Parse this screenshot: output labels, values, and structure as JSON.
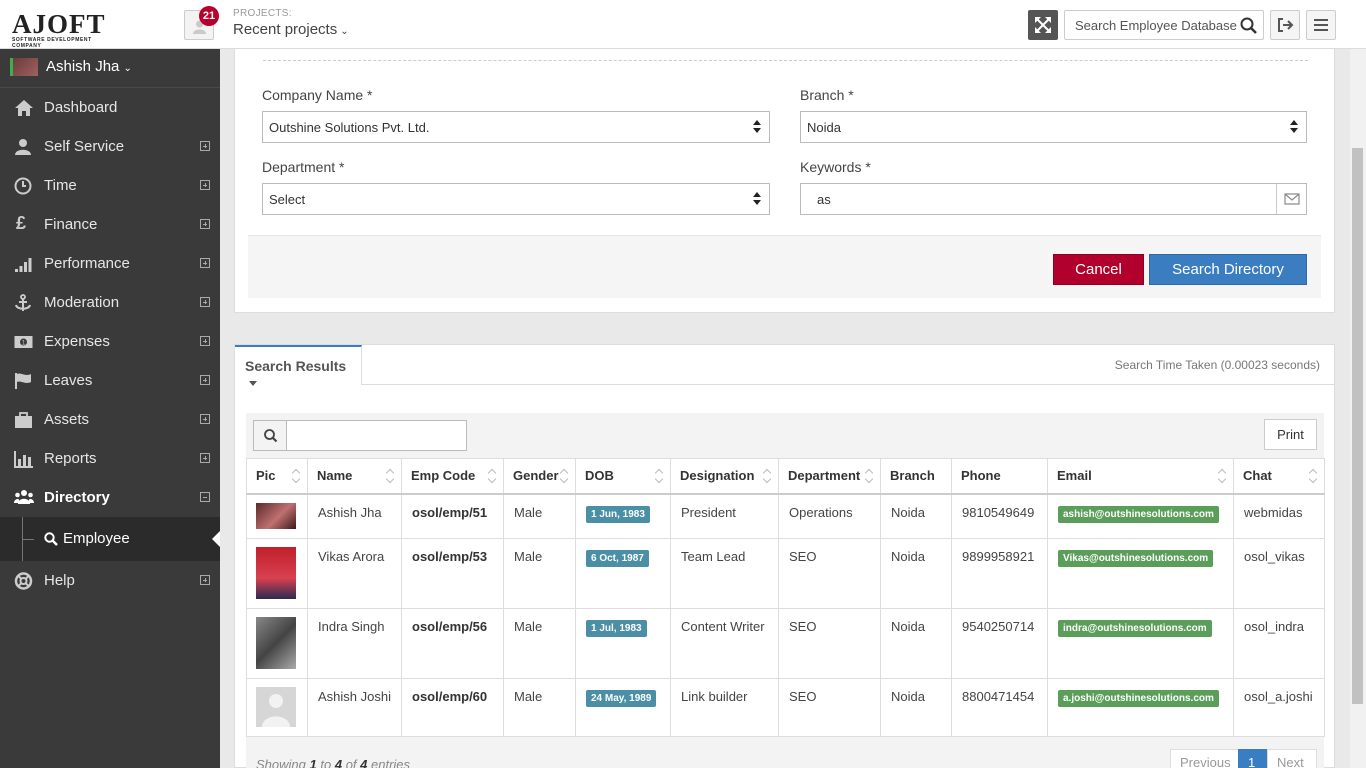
{
  "header": {
    "logo_text": "AJOFT",
    "logo_subtext": "SOFTWARE DEVELOPMENT COMPANY",
    "notification_count": "21",
    "projects_label": "PROJECTS:",
    "projects_value": "Recent projects",
    "search_placeholder": "Search Employee Database"
  },
  "sidebar": {
    "user_name": "Ashish Jha",
    "items": [
      {
        "label": "Dashboard",
        "icon": "home-icon"
      },
      {
        "label": "Self Service",
        "icon": "users-icon"
      },
      {
        "label": "Time",
        "icon": "clock-icon"
      },
      {
        "label": "Finance",
        "icon": "pound-icon"
      },
      {
        "label": "Performance",
        "icon": "signal-icon"
      },
      {
        "label": "Moderation",
        "icon": "anchor-icon"
      },
      {
        "label": "Expenses",
        "icon": "money-icon"
      },
      {
        "label": "Leaves",
        "icon": "flag-icon"
      },
      {
        "label": "Assets",
        "icon": "briefcase-icon"
      },
      {
        "label": "Reports",
        "icon": "bar-chart-icon"
      },
      {
        "label": "Directory",
        "icon": "group-icon"
      },
      {
        "label": "Help",
        "icon": "lifebuoy-icon"
      }
    ],
    "sub_item": "Employee"
  },
  "form": {
    "company_label": "Company Name *",
    "company_value": "Outshine Solutions Pvt. Ltd.",
    "branch_label": "Branch *",
    "branch_value": "Noida",
    "department_label": "Department *",
    "department_value": "Select",
    "keywords_label": "Keywords *",
    "keywords_value": "as",
    "cancel_label": "Cancel",
    "search_label": "Search Directory"
  },
  "results": {
    "tab_label": "Search Results",
    "time_taken": "Search Time Taken (0.00023 seconds)",
    "print_label": "Print",
    "columns": [
      "Pic",
      "Name",
      "Emp Code",
      "Gender",
      "DOB",
      "Designation",
      "Department",
      "Branch",
      "Phone",
      "Email",
      "Chat"
    ],
    "rows": [
      {
        "name": "Ashish Jha",
        "code": "osol/emp/51",
        "gender": "Male",
        "dob": "1 Jun, 1983",
        "designation": "President",
        "department": "Operations",
        "branch": "Noida",
        "phone": "9810549649",
        "email": "ashish@outshinesolutions.com",
        "chat": "webmidas"
      },
      {
        "name": "Vikas Arora",
        "code": "osol/emp/53",
        "gender": "Male",
        "dob": "6 Oct, 1987",
        "designation": "Team Lead",
        "department": "SEO",
        "branch": "Noida",
        "phone": "9899958921",
        "email": "Vikas@outshinesolutions.com",
        "chat": "osol_vikas"
      },
      {
        "name": "Indra Singh",
        "code": "osol/emp/56",
        "gender": "Male",
        "dob": "1 Jul, 1983",
        "designation": "Content Writer",
        "department": "SEO",
        "branch": "Noida",
        "phone": "9540250714",
        "email": "indra@outshinesolutions.com",
        "chat": "osol_indra"
      },
      {
        "name": "Ashish Joshi",
        "code": "osol/emp/60",
        "gender": "Male",
        "dob": "24 May, 1989",
        "designation": "Link builder",
        "department": "SEO",
        "branch": "Noida",
        "phone": "8800471454",
        "email": "a.joshi@outshinesolutions.com",
        "chat": "osol_a.joshi"
      }
    ],
    "showing": {
      "prefix": "Showing",
      "from": "1",
      "to_word": "to",
      "to": "4",
      "of_word": "of",
      "total": "4",
      "suffix": "entries"
    },
    "pager": {
      "previous": "Previous",
      "page": "1",
      "next": "Next"
    }
  }
}
